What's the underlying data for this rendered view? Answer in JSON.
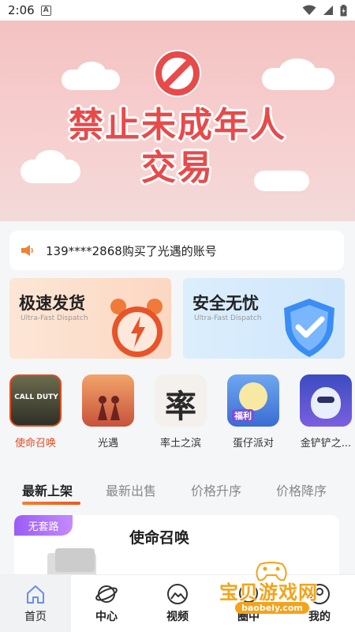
{
  "status_bar": {
    "time": "2:06",
    "notification_glyph": "A"
  },
  "banner": {
    "line1": "禁止未成年人",
    "line2": "交易",
    "icon": "prohibited-icon",
    "accent": "#e84a4a"
  },
  "notice": {
    "text": "139****2868购买了光遇的账号",
    "icon": "speaker-icon"
  },
  "promos": [
    {
      "title": "极速发货",
      "subtitle": "Ultra-Fast Dispatch",
      "icon": "alarm-clock-icon"
    },
    {
      "title": "安全无忧",
      "subtitle": "Ultra-Fast Dispatch",
      "icon": "shield-check-icon"
    }
  ],
  "games": [
    {
      "label": "使命召唤",
      "selected": true,
      "icon_text": "CALL DUTY"
    },
    {
      "label": "光遇",
      "selected": false
    },
    {
      "label": "率土之滨",
      "selected": false,
      "icon_text": "率"
    },
    {
      "label": "蛋仔派对",
      "selected": false,
      "icon_text": "福利"
    },
    {
      "label": "金铲铲之...",
      "selected": false
    }
  ],
  "tabs": [
    {
      "label": "最新上架",
      "active": true
    },
    {
      "label": "最新出售",
      "active": false
    },
    {
      "label": "价格升序",
      "active": false
    },
    {
      "label": "价格降序",
      "active": false
    }
  ],
  "listing": {
    "tag": "无套路",
    "title": "使命召唤"
  },
  "bottom_nav": [
    {
      "label": "首页",
      "icon": "home-icon",
      "active": true
    },
    {
      "label": "中心",
      "icon": "planet-icon",
      "active": false
    },
    {
      "label": "视频",
      "icon": "image-icon",
      "active": false
    },
    {
      "label": "圈中",
      "icon": "chat-icon",
      "active": false
    },
    {
      "label": "我的",
      "icon": "profile-icon",
      "active": false
    }
  ],
  "watermark": {
    "text": "宝贝游戏网",
    "url": "baobeiy.com"
  },
  "colors": {
    "accent_orange": "#e8491d",
    "tag_purple": "#9a5cf5",
    "watermark": "#f4a31a"
  }
}
